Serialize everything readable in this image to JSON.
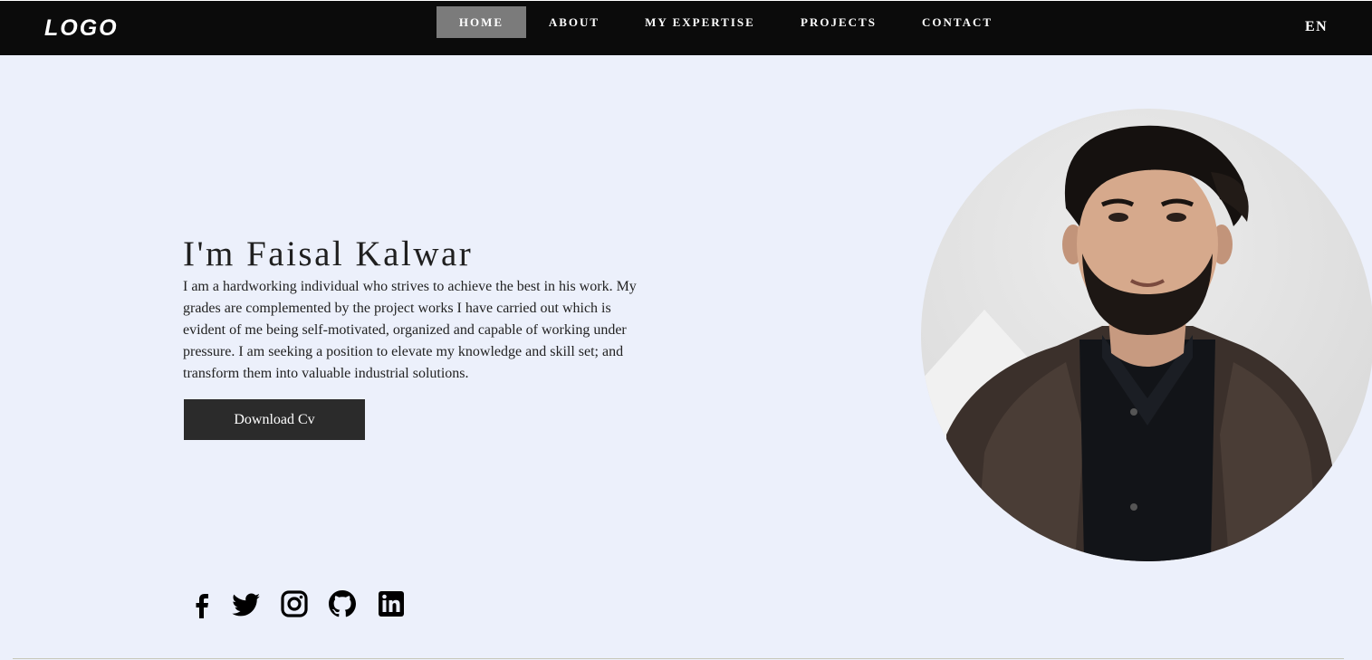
{
  "header": {
    "logo": "LOGO",
    "nav": [
      {
        "label": "HOME",
        "active": true
      },
      {
        "label": "ABOUT",
        "active": false
      },
      {
        "label": "MY EXPERTISE",
        "active": false
      },
      {
        "label": "PROJECTS",
        "active": false
      },
      {
        "label": "CONTACT",
        "active": false
      }
    ],
    "language": "EN"
  },
  "hero": {
    "title": "I'm Faisal Kalwar",
    "description": "I am a hardworking individual who strives to achieve the best in his work. My grades are complemented by the project works I have carried out which is evident of me being self-motivated, organized and capable of working under pressure. I am seeking a position to elevate my knowledge and skill set; and transform them into valuable industrial solutions.",
    "cv_button": "Download Cv"
  },
  "socials": [
    {
      "icon": "facebook-icon"
    },
    {
      "icon": "twitter-icon"
    },
    {
      "icon": "instagram-icon"
    },
    {
      "icon": "github-icon"
    },
    {
      "icon": "linkedin-icon"
    }
  ],
  "colors": {
    "page_background": "#ecf0fb",
    "navbar": "#0b0b0b",
    "nav_active": "#7b7b7b",
    "button": "#2b2b2b"
  }
}
